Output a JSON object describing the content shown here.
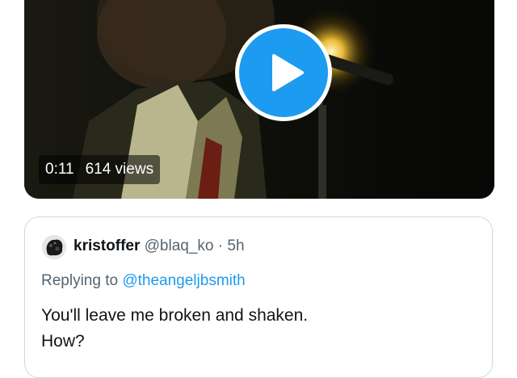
{
  "video": {
    "duration": "0:11",
    "views": "614 views"
  },
  "quote": {
    "display_name": "kristoffer",
    "handle": "@blaq_ko",
    "separator": "·",
    "time": "5h",
    "replying_prefix": "Replying to",
    "replying_handle": "@theangeljbsmith",
    "text_lines": [
      "You'll leave me broken and shaken.",
      "How?"
    ]
  },
  "colors": {
    "accent": "#1d9bf0",
    "text_primary": "#0f1419",
    "text_secondary": "#536471",
    "border": "#cfd9de"
  },
  "icons": {
    "play": "play-icon"
  }
}
